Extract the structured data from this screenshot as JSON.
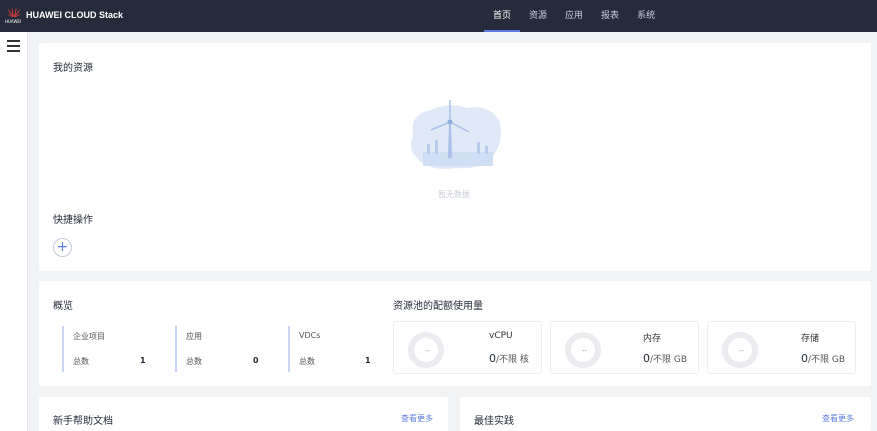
{
  "header": {
    "logo_text": "HUAWEI",
    "brand": "HUAWEI CLOUD Stack",
    "nav": [
      "首页",
      "资源",
      "应用",
      "报表",
      "系统"
    ],
    "active_nav": "首页",
    "bg_color": "#252b3a",
    "accent_color": "#5e7ce0"
  },
  "sidebar": {
    "menu_icon": "hamburger-icon"
  },
  "resources": {
    "title": "我的资源",
    "empty_text": "暂无数据",
    "empty_icon": "wind-turbine-illustration"
  },
  "quick_ops": {
    "title": "快捷操作",
    "add_symbol": "+"
  },
  "overview": {
    "title": "概览",
    "stats": [
      {
        "name": "企业项目",
        "total_label": "总数",
        "value": "1"
      },
      {
        "name": "应用",
        "total_label": "总数",
        "value": "0"
      },
      {
        "name": "VDCs",
        "total_label": "总数",
        "value": "1"
      }
    ]
  },
  "quota": {
    "title": "资源池的配额使用量",
    "items": [
      {
        "name": "vCPU",
        "used": "0",
        "limit_text": "/不限 核",
        "ring_label": "--"
      },
      {
        "name": "内存",
        "used": "0",
        "limit_text": "/不限 GB",
        "ring_label": "--"
      },
      {
        "name": "存储",
        "used": "0",
        "limit_text": "/不限 GB",
        "ring_label": "--"
      }
    ]
  },
  "help": {
    "title": "新手帮助文档",
    "more": "查看更多"
  },
  "best": {
    "title": "最佳实践",
    "more": "查看更多"
  }
}
